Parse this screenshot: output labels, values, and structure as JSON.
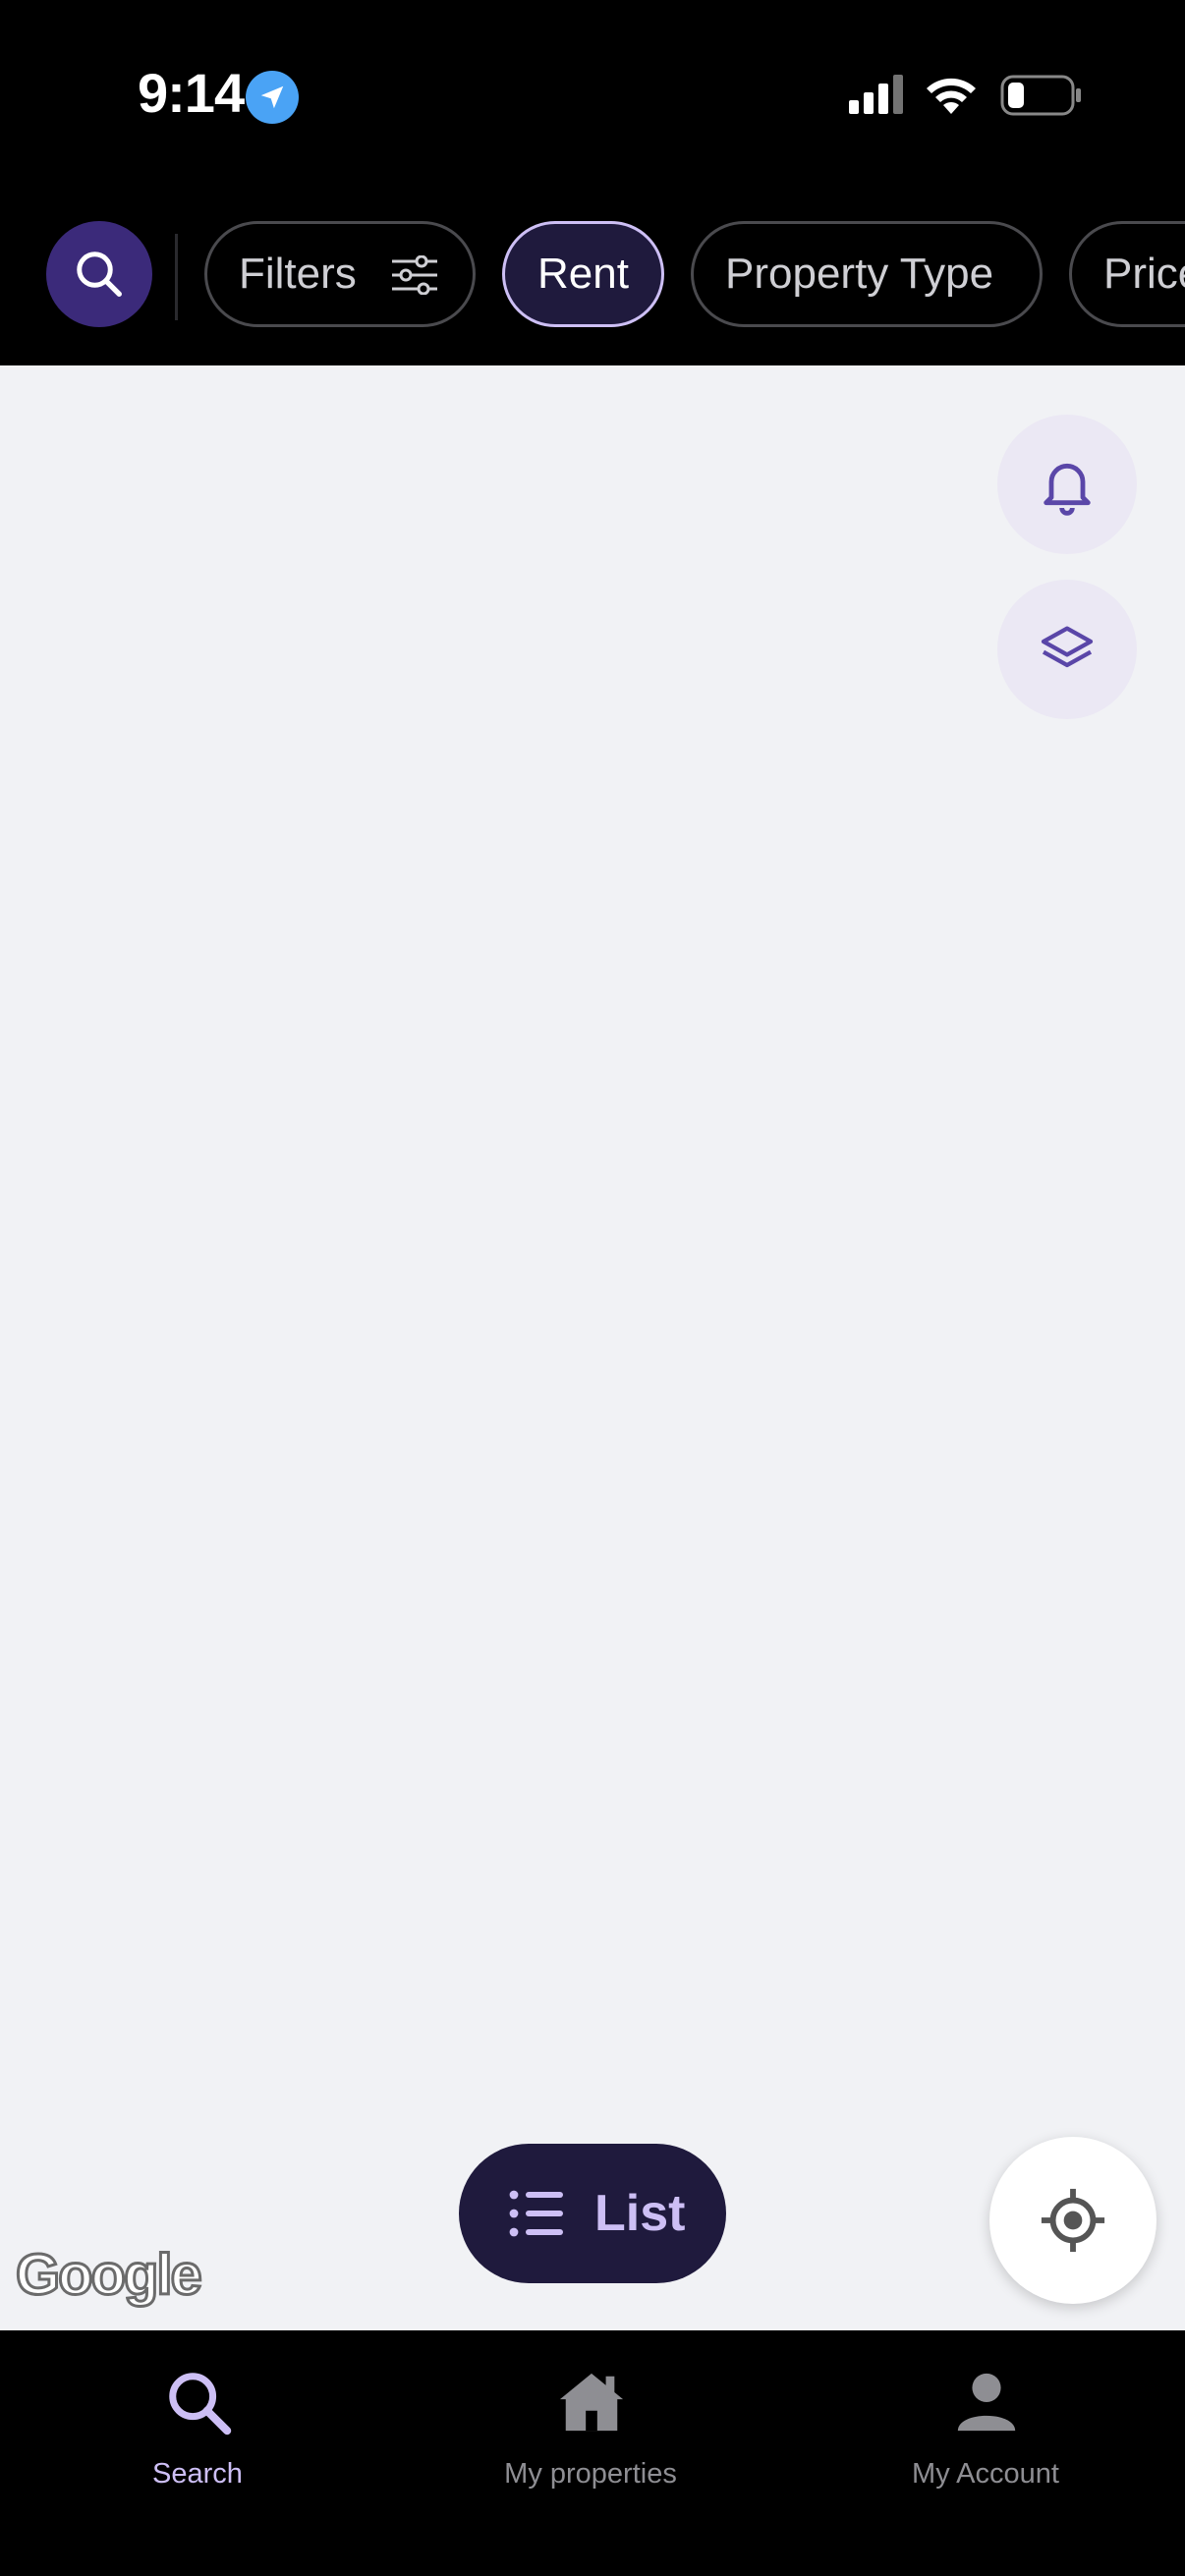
{
  "status_bar": {
    "time": "9:14",
    "icons": [
      "location-arrow-icon",
      "cellular-signal-icon",
      "wifi-icon",
      "battery-icon"
    ]
  },
  "filter_bar": {
    "search_icon": "search-icon",
    "chips": [
      {
        "label": "Filters",
        "icon": "sliders-icon",
        "selected": false
      },
      {
        "label": "Rent",
        "selected": true
      },
      {
        "label": "Property Type",
        "selected": false
      },
      {
        "label": "Price",
        "selected": false
      }
    ]
  },
  "map": {
    "controls": [
      "bell-icon",
      "layers-icon"
    ],
    "list_button": {
      "label": "List",
      "icon": "list-icon"
    },
    "locate_icon": "crosshair-icon",
    "attribution": "Google"
  },
  "bottom_nav": {
    "items": [
      {
        "label": "Search",
        "icon": "search-icon",
        "active": true
      },
      {
        "label": "My properties",
        "icon": "house-icon",
        "active": false
      },
      {
        "label": "My Account",
        "icon": "person-icon",
        "active": false
      }
    ]
  },
  "colors": {
    "accent": "#cdbff5",
    "brand_dark": "#1f1a3d",
    "search_circle": "#3b2a7a",
    "map_background": "#f1f2f5",
    "icon_purple": "#5a46a8"
  }
}
